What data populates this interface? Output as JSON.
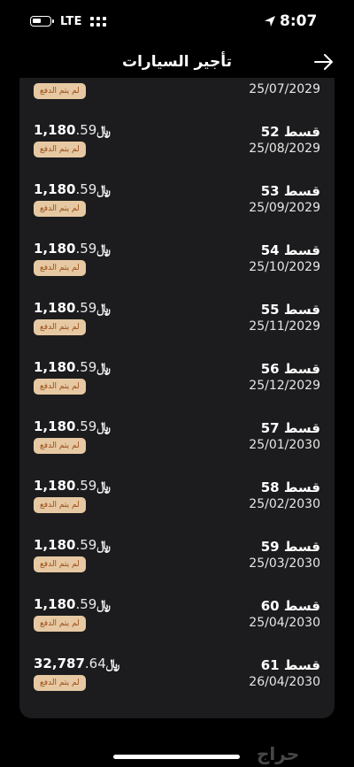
{
  "status_bar": {
    "carrier": "LTE",
    "time": "8:07"
  },
  "header": {
    "title": "تأجير السيارات",
    "back_icon": "arrow-right-icon"
  },
  "currency_symbol": "﷼",
  "first_row": {
    "date": "25/07/2029",
    "status": "لم يتم الدفع"
  },
  "installments": [
    {
      "label": "قسط 52",
      "date": "25/08/2029",
      "amount_int": "1,180",
      "amount_dec": ".59",
      "status": "لم يتم الدفع"
    },
    {
      "label": "قسط 53",
      "date": "25/09/2029",
      "amount_int": "1,180",
      "amount_dec": ".59",
      "status": "لم يتم الدفع"
    },
    {
      "label": "قسط 54",
      "date": "25/10/2029",
      "amount_int": "1,180",
      "amount_dec": ".59",
      "status": "لم يتم الدفع"
    },
    {
      "label": "قسط 55",
      "date": "25/11/2029",
      "amount_int": "1,180",
      "amount_dec": ".59",
      "status": "لم يتم الدفع"
    },
    {
      "label": "قسط 56",
      "date": "25/12/2029",
      "amount_int": "1,180",
      "amount_dec": ".59",
      "status": "لم يتم الدفع"
    },
    {
      "label": "قسط 57",
      "date": "25/01/2030",
      "amount_int": "1,180",
      "amount_dec": ".59",
      "status": "لم يتم الدفع"
    },
    {
      "label": "قسط 58",
      "date": "25/02/2030",
      "amount_int": "1,180",
      "amount_dec": ".59",
      "status": "لم يتم الدفع"
    },
    {
      "label": "قسط 59",
      "date": "25/03/2030",
      "amount_int": "1,180",
      "amount_dec": ".59",
      "status": "لم يتم الدفع"
    },
    {
      "label": "قسط 60",
      "date": "25/04/2030",
      "amount_int": "1,180",
      "amount_dec": ".59",
      "status": "لم يتم الدفع"
    },
    {
      "label": "قسط 61",
      "date": "26/04/2030",
      "amount_int": "32,787",
      "amount_dec": ".64",
      "status": "لم يتم الدفع"
    }
  ],
  "watermark": "حراج",
  "colors": {
    "background": "#000000",
    "card": "#1c1c1e",
    "badge_bg": "#e6c9a3",
    "badge_text": "#9a4b18"
  }
}
